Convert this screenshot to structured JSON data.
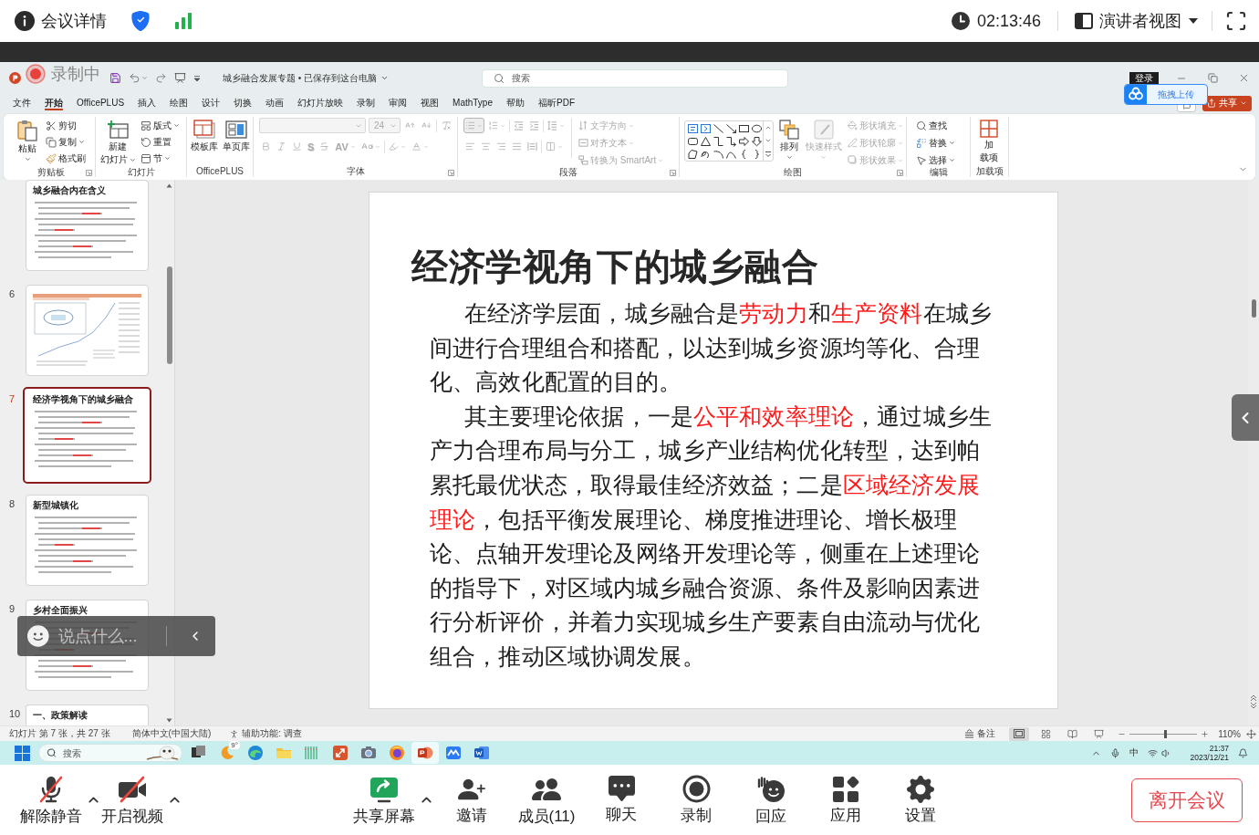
{
  "meeting_bar": {
    "details": "会议详情",
    "timer": "02:13:46",
    "view_mode": "演讲者视图"
  },
  "recording": {
    "label": "录制中"
  },
  "powerpoint": {
    "doc_title": "城乡融合发展专题 • 已保存到这台电脑",
    "search": {
      "placeholder": "搜索"
    },
    "sign_in": "登录",
    "upload_tip": "拖拽上传",
    "share": "共享",
    "menu": [
      {
        "label": "文件",
        "selected": false
      },
      {
        "label": "开始",
        "selected": true
      },
      {
        "label": "OfficePLUS",
        "selected": false
      },
      {
        "label": "插入",
        "selected": false
      },
      {
        "label": "绘图",
        "selected": false
      },
      {
        "label": "设计",
        "selected": false
      },
      {
        "label": "切换",
        "selected": false
      },
      {
        "label": "动画",
        "selected": false
      },
      {
        "label": "幻灯片放映",
        "selected": false
      },
      {
        "label": "录制",
        "selected": false
      },
      {
        "label": "审阅",
        "selected": false
      },
      {
        "label": "视图",
        "selected": false
      },
      {
        "label": "MathType",
        "selected": false
      },
      {
        "label": "帮助",
        "selected": false
      },
      {
        "label": "福昕PDF",
        "selected": false
      }
    ],
    "ribbon": {
      "clipboard": {
        "label": "剪贴板",
        "paste": "粘贴",
        "cut": "剪切",
        "copy": "复制",
        "format_painter": "格式刷"
      },
      "slides": {
        "label": "幻灯片",
        "new_slide": [
          "新建",
          "幻灯片"
        ],
        "layout": "版式",
        "reset": "重置",
        "section": "节"
      },
      "officeplus": {
        "label": "OfficePLUS",
        "templates": "模板库",
        "single_pages": "单页库"
      },
      "font": {
        "label": "字体",
        "disabled": true,
        "size": "24",
        "shadow": "S",
        "spacing": "AV"
      },
      "paragraph": {
        "label": "段落",
        "disabled": true,
        "bullets_on": true,
        "text_direction": "文字方向",
        "align_text": "对齐文本",
        "smartart": "转换为 SmartArt"
      },
      "drawing": {
        "label": "绘图",
        "arrange": "排列",
        "quick_styles": {
          "label": "快速样式",
          "disabled": true
        },
        "shape_format": [
          {
            "label": "形状填充",
            "disabled": true
          },
          {
            "label": "形状轮廓",
            "disabled": true
          },
          {
            "label": "形状效果",
            "disabled": true
          }
        ]
      },
      "editing": {
        "label": "编辑",
        "find": "查找",
        "replace": "替换",
        "select": "选择"
      },
      "addins": {
        "label": "加载项",
        "button": [
          "加",
          "载项"
        ]
      }
    },
    "thumbnails": [
      {
        "title": "城乡融合内在含义",
        "kind": "text",
        "selected": false
      },
      {
        "number": "6",
        "kind": "chart",
        "selected": false
      },
      {
        "number": "7",
        "title": "经济学视角下的城乡融合",
        "kind": "text",
        "selected": true
      },
      {
        "number": "8",
        "title": "新型城镇化",
        "kind": "text",
        "selected": false
      },
      {
        "number": "9",
        "title": "乡村全面振兴",
        "kind": "text",
        "selected": false
      },
      {
        "number": "10",
        "title": "一、政策解读",
        "kind": "text",
        "selected": false
      }
    ],
    "slide": {
      "title": "经济学视角下的城乡融合",
      "paragraphs": [
        [
          {
            "text": "在经济学层面，城乡融合是",
            "emphasis": false
          },
          {
            "text": "劳动力",
            "emphasis": true
          },
          {
            "text": "和",
            "emphasis": false
          },
          {
            "text": "生产资料",
            "emphasis": true
          },
          {
            "text": "在城乡间进行合理组合和搭配，以达到城乡资源均等化、合理化、高效化配置的目的。",
            "emphasis": false
          }
        ],
        [
          {
            "text": "其主要理论依据，一是",
            "emphasis": false
          },
          {
            "text": "公平和效率理论",
            "emphasis": true
          },
          {
            "text": "，通过城乡生产力合理布局与分工，城乡产业结构优化转型，达到帕累托最优状态，取得最佳经济效益；二是",
            "emphasis": false
          },
          {
            "text": "区域经济发展理论",
            "emphasis": true
          },
          {
            "text": "，包括平衡发展理论、梯度推进理论、增长极理论、点轴开发理论及网络开发理论等，侧重在上述理论的指导下，对区域内城乡融合资源、条件及影响因素进行分析评价，并着力实现城乡生产要素自由流动与优化组合，推动区域协调发展。",
            "emphasis": false
          }
        ]
      ]
    },
    "status_bar": {
      "slide_info": "幻灯片 第 7 张，共 27 张",
      "language": "简体中文(中国大陆)",
      "accessibility": "辅助功能: 调查",
      "notes": "备注",
      "views": [
        {
          "selected": true
        },
        {
          "selected": false
        },
        {
          "selected": false
        },
        {
          "selected": false
        }
      ],
      "zoom": {
        "level": 0.53,
        "reading": "110%"
      }
    }
  },
  "chat_overlay": {
    "placeholder": "说点什么..."
  },
  "taskbar": {
    "search": {
      "placeholder": "搜索"
    },
    "weather": "9°",
    "apps": [
      {
        "active": false
      },
      {
        "active": false
      },
      {
        "active": false
      },
      {
        "active": false
      },
      {
        "active": false
      },
      {
        "active": false
      },
      {
        "active": false
      },
      {
        "active": true
      },
      {
        "active": false
      },
      {
        "active": false
      }
    ],
    "ime": "中",
    "time": "21:37",
    "date": "2023/12/21"
  },
  "toolbar": {
    "audio": {
      "label": "解除静音",
      "muted": true
    },
    "video": {
      "label": "开启视频",
      "on": false
    },
    "share": {
      "label": "共享屏幕"
    },
    "actions": [
      {
        "label": "邀请"
      },
      {
        "label": "成员(11)"
      },
      {
        "label": "聊天"
      },
      {
        "label": "录制"
      },
      {
        "label": "回应"
      },
      {
        "label": "应用"
      },
      {
        "label": "设置"
      }
    ],
    "leave": "离开会议"
  }
}
